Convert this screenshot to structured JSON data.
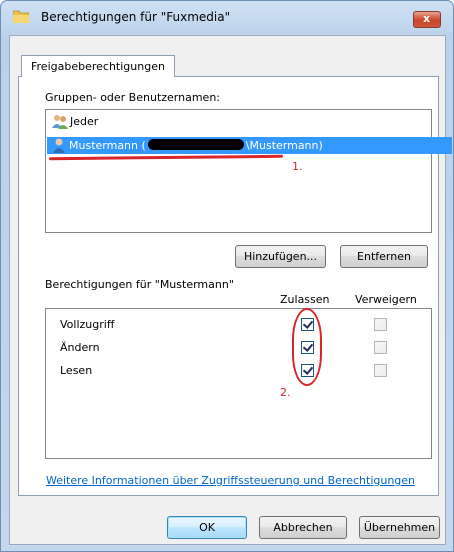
{
  "window": {
    "title": "Berechtigungen für \"Fuxmedia\"",
    "close_glyph": "x"
  },
  "tabs": [
    {
      "label": "Freigabeberechtigungen"
    }
  ],
  "groups": {
    "label": "Gruppen- oder Benutzernamen:",
    "items": [
      {
        "name": "Jeder",
        "icon": "users-group-icon"
      },
      {
        "name": "Mustermann (",
        "name_suffix": "\\Mustermann)",
        "icon": "user-icon",
        "selected": true
      }
    ],
    "annotation": "1."
  },
  "buttons": {
    "add": "Hinzufügen...",
    "remove": "Entfernen"
  },
  "permissions": {
    "label": "Berechtigungen für \"Mustermann\"",
    "col_allow": "Zulassen",
    "col_deny": "Verweigern",
    "rows": [
      {
        "name": "Vollzugriff",
        "allow": true,
        "deny": false
      },
      {
        "name": "Ändern",
        "allow": true,
        "deny": false
      },
      {
        "name": "Lesen",
        "allow": true,
        "deny": false
      }
    ],
    "annotation": "2."
  },
  "link_text": "Weitere Informationen über Zugriffssteuerung und Berechtigungen",
  "footer": {
    "ok": "OK",
    "cancel": "Abbrechen",
    "apply": "Übernehmen"
  },
  "colors": {
    "selection": "#3399ff",
    "annotation_red": "#d9262a",
    "link": "#0066cc"
  }
}
